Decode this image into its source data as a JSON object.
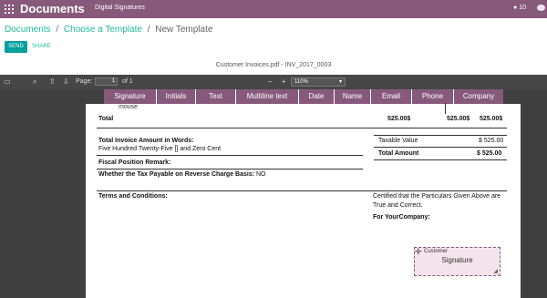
{
  "topbar": {
    "app_title": "Documents",
    "nav_link": "Digital Signatures",
    "notification_count": "10",
    "icons": [
      "apps-icon",
      "bell-icon",
      "chat-icon"
    ]
  },
  "breadcrumb": {
    "items": [
      "Documents",
      "Choose a Template",
      "New Template"
    ],
    "separator": "/"
  },
  "actions": {
    "send_label": "SEND",
    "share_label": "SHARE"
  },
  "document": {
    "title": "Customer Invoices.pdf - INV_2017_0003"
  },
  "pdf_toolbar": {
    "page_label": "Page:",
    "page_value": "1",
    "page_of": "of 1",
    "zoom_out": "−",
    "zoom_in": "+",
    "zoom_value": "110%",
    "zoom_caret": "▾",
    "icons": [
      "sidebar-toggle-icon",
      "search-icon",
      "previous-page-icon",
      "next-page-icon"
    ]
  },
  "signature_fields": [
    "Signature",
    "Initials",
    "Text",
    "Multiline text",
    "Date",
    "Name",
    "Email",
    "Phone",
    "Company"
  ],
  "invoice": {
    "cursor_word": "mouse",
    "total_label": "Total",
    "total_col1": "525.00$",
    "total_col2": "525.00$",
    "total_col3": "525.00$",
    "amount_words_label": "Total Invoice Amount in Words:",
    "amount_words_value": "Five Hundred Twenty-Five [] and Zero Cent",
    "fiscal_remark_label": "Fiscal Position Remark:",
    "reverse_charge_label": "Whether the Tax Payable on Reverse Charge Basis:",
    "reverse_charge_value": "NO",
    "taxable_label": "Taxable Value",
    "taxable_value": "$ 525.00",
    "total_amount_label": "Total Amount",
    "total_amount_value": "$ 525.00",
    "terms_label": "Terms and Conditions:",
    "certified_line1": "Certified that the Particulars Given Above are",
    "certified_line2": "True and Correct.",
    "for_company": "For YourCompany:"
  },
  "signature_box": {
    "role": "Customer",
    "type": "Signature",
    "move_glyph": "✛",
    "resize_glyph": "◢"
  }
}
